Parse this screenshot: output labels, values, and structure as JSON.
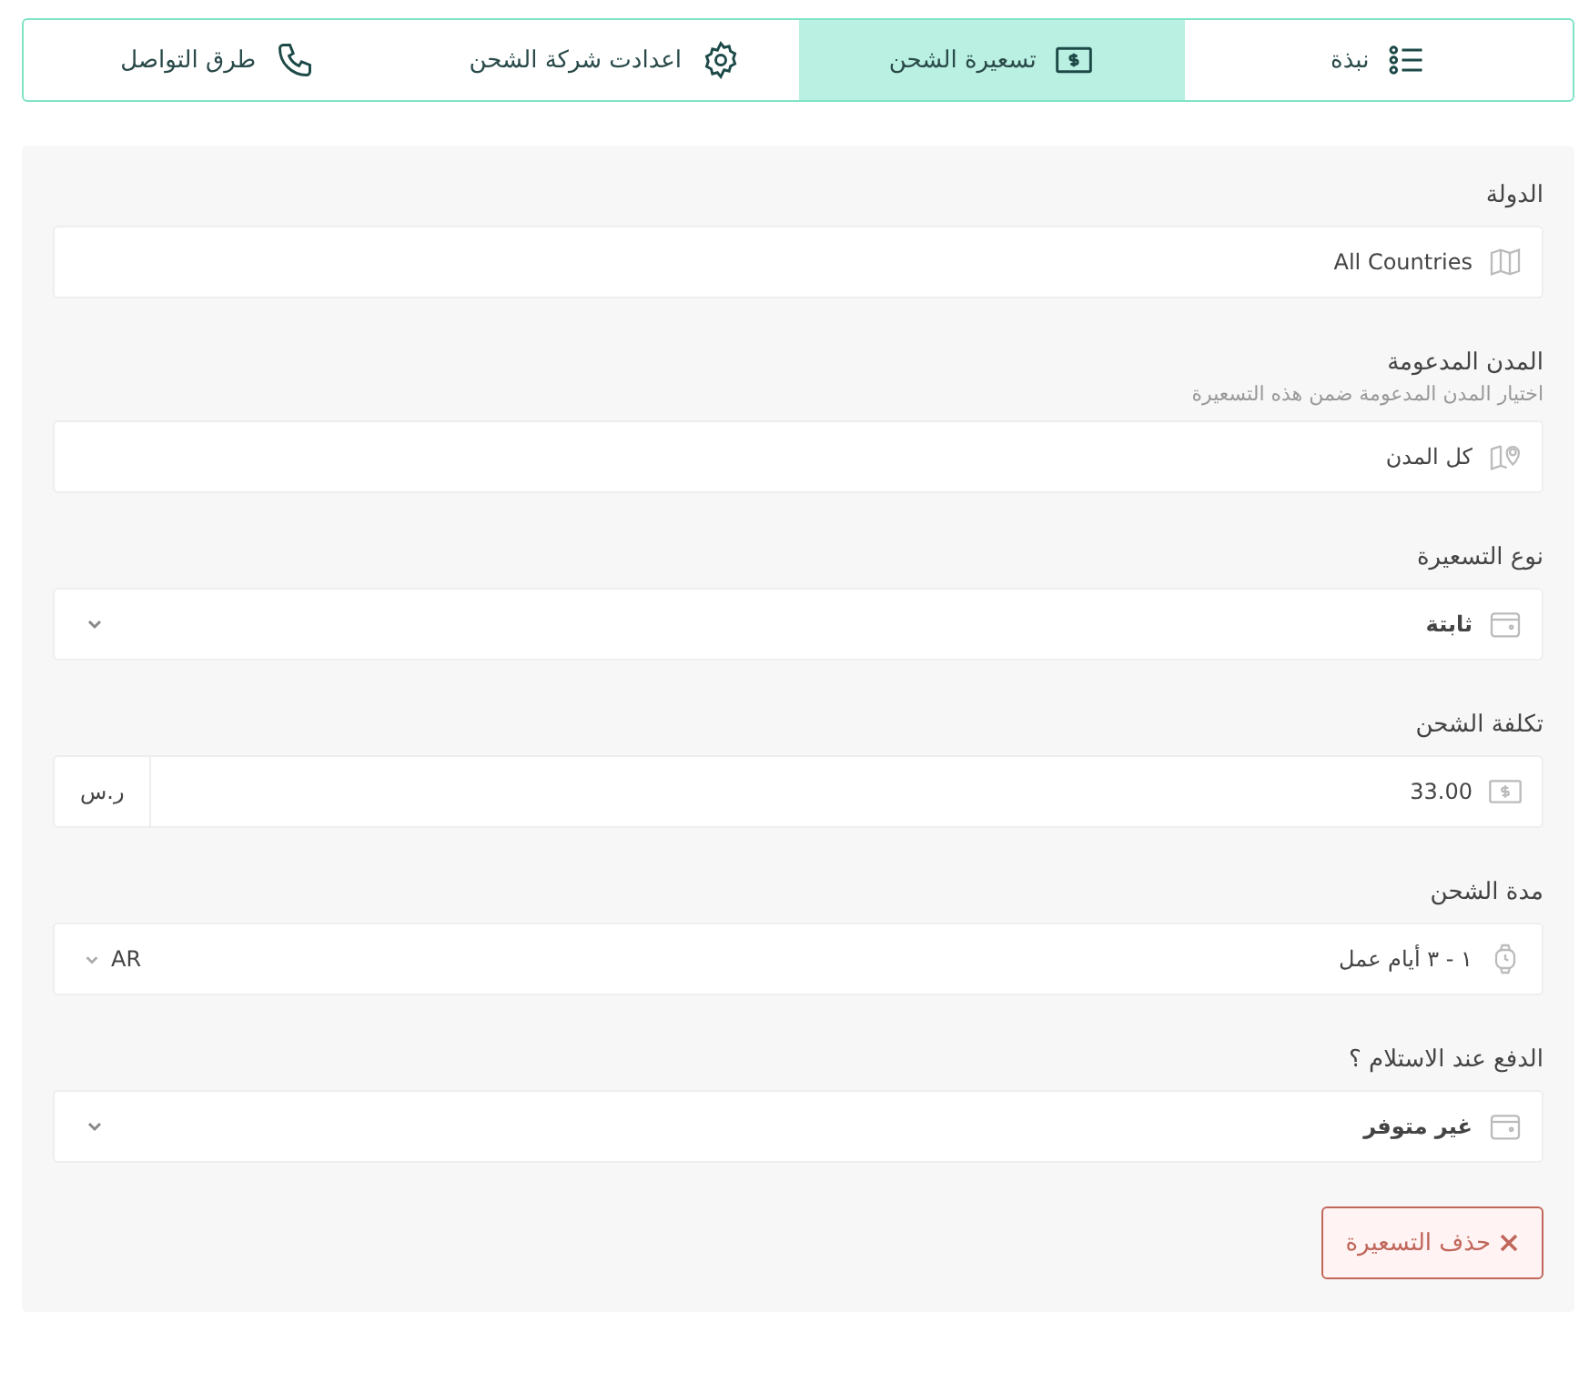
{
  "tabs": [
    {
      "label": "نبذة",
      "selected": false
    },
    {
      "label": "تسعيرة الشحن",
      "selected": true
    },
    {
      "label": "اعدادت شركة الشحن",
      "selected": false
    },
    {
      "label": "طرق التواصل",
      "selected": false
    }
  ],
  "fields": [
    {
      "kind": "text",
      "label": "الدولة",
      "value": "All Countries"
    },
    {
      "kind": "text",
      "label": "المدن المدعومة",
      "hint": "اختيار المدن المدعومة ضمن هذه التسعيرة",
      "value": "كل المدن"
    },
    {
      "kind": "select",
      "label": "نوع التسعيرة",
      "value": "ثابتة"
    },
    {
      "kind": "currency",
      "label": "تكلفة الشحن",
      "value": "33.00",
      "unit": "ر.س"
    },
    {
      "kind": "duration",
      "label": "مدة الشحن",
      "value": "١ - ٣ أيام عمل",
      "language": "AR"
    },
    {
      "kind": "select",
      "label": "الدفع عند الاستلام ؟",
      "value": "غير متوفر"
    }
  ],
  "delete_button": "حذف التسعيرة"
}
